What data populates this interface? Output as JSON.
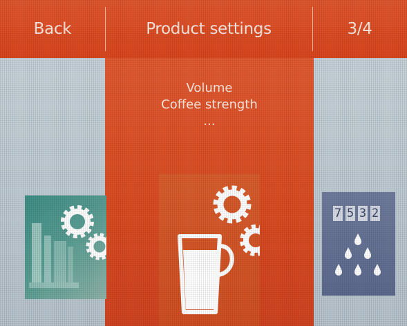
{
  "header": {
    "back_label": "Back",
    "title": "Product settings",
    "page_indicator": "3/4"
  },
  "carousel": {
    "selected": {
      "lines": [
        "Volume",
        "Coffee strength",
        "..."
      ],
      "icon": "cup-with-gears-icon"
    },
    "previous": {
      "icon": "machine-with-gears-icon"
    },
    "next": {
      "icon": "counter-with-drops-icon",
      "digits": [
        "7",
        "5",
        "3",
        "2"
      ]
    }
  },
  "colors": {
    "accent_orange": "#d9461f",
    "header_text": "#fbe8e0",
    "side_panel": "#c2cdd6",
    "teal_tile": "#3f8e86",
    "slate_tile": "#6f7b9c"
  }
}
